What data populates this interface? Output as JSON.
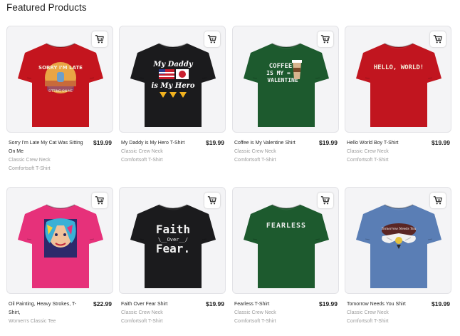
{
  "section": {
    "title": "Featured Products"
  },
  "products": [
    {
      "title": "Sorry I'm Late My Cat Was Sitting On Me",
      "price": "$19.99",
      "style": "Classic Crew Neck",
      "material": "Comfortsoft T-Shirt",
      "shirt_color": "#c4151e",
      "art": "sorry-late-cat"
    },
    {
      "title": "My Daddy is My Hero T-Shirt",
      "price": "$19.99",
      "style": "Classic Crew Neck",
      "material": "Comfortsoft T-Shirt",
      "shirt_color": "#1b1b1d",
      "art": "daddy-hero",
      "art_text": [
        "My Daddy",
        "is My Hero"
      ]
    },
    {
      "title": "Coffee is My Valentine Shirt",
      "price": "$19.99",
      "style": "Classic Crew Neck",
      "material": "Comfortsoft T-Shirt",
      "shirt_color": "#1d5a2e",
      "art": "coffee-valentine",
      "art_text": [
        "COFFEE",
        "IS MY",
        "VALENTINE"
      ]
    },
    {
      "title": "Hello World Boy T-Shirt",
      "price": "$19.99",
      "style": "Classic Crew Neck",
      "material": "Comfortsoft T-Shirt",
      "shirt_color": "#c1151f",
      "art": "hello-world",
      "art_text": [
        "HELLO, WORLD!"
      ]
    },
    {
      "title": "Oil Painting, Heavy Strokes, T-Shirt,",
      "price": "$22.99",
      "style": "Women's Classic Tee",
      "material": "",
      "shirt_color": "#e6317a",
      "art": "oil-painting"
    },
    {
      "title": "Faith Over Fear Shirt",
      "price": "$19.99",
      "style": "Classic Crew Neck",
      "material": "Comfortsoft T-Shirt",
      "shirt_color": "#1b1b1d",
      "art": "faith-fear",
      "art_text": [
        "Faith",
        "Over",
        "Fear."
      ]
    },
    {
      "title": "Fearless T-Shirt",
      "price": "$19.99",
      "style": "Classic Crew Neck",
      "material": "Comfortsoft T-Shirt",
      "shirt_color": "#1d5a2e",
      "art": "fearless",
      "art_text": [
        "FEARLESS"
      ]
    },
    {
      "title": "Tomorrow Needs You Shirt",
      "price": "$19.99",
      "style": "Classic Crew Neck",
      "material": "Comfortsoft T-Shirt",
      "shirt_color": "#5a7eb5",
      "art": "tomorrow",
      "art_text": [
        "Tomorrow Needs You"
      ]
    }
  ],
  "icons": {
    "cart": "shopping-cart-icon"
  }
}
